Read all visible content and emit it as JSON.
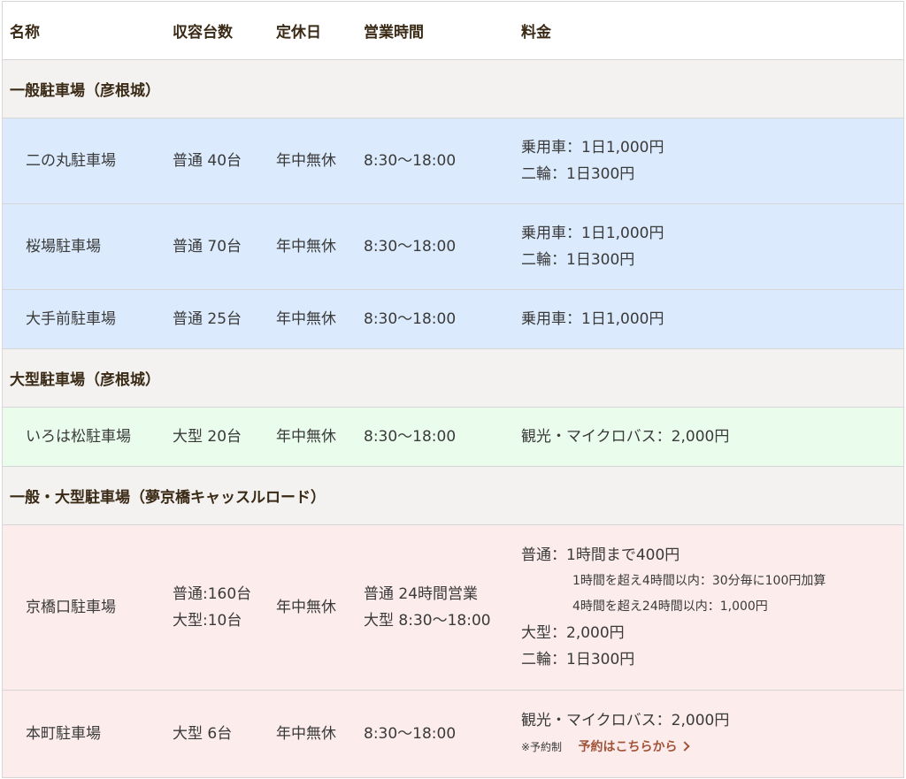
{
  "header": {
    "name": "名称",
    "capacity": "収容台数",
    "closed": "定休日",
    "hours": "営業時間",
    "fee": "料金"
  },
  "sections": [
    {
      "title": "一般駐車場（彦根城）",
      "rows": [
        {
          "name": "二の丸駐車場",
          "capacity": "普通 40台",
          "closed": "年中無休",
          "hours": "8:30〜18:00",
          "fee": [
            "乗用車：1日1,000円",
            "二輪：1日300円"
          ]
        },
        {
          "name": "桜場駐車場",
          "capacity": "普通 70台",
          "closed": "年中無休",
          "hours": "8:30〜18:00",
          "fee": [
            "乗用車：1日1,000円",
            "二輪：1日300円"
          ]
        },
        {
          "name": "大手前駐車場",
          "capacity": "普通 25台",
          "closed": "年中無休",
          "hours": "8:30〜18:00",
          "fee": [
            "乗用車：1日1,000円"
          ]
        }
      ]
    },
    {
      "title": "大型駐車場（彦根城）",
      "rows": [
        {
          "name": "いろは松駐車場",
          "capacity": "大型 20台",
          "closed": "年中無休",
          "hours": "8:30〜18:00",
          "fee": [
            "観光・マイクロバス：2,000円"
          ]
        }
      ]
    },
    {
      "title": "一般・大型駐車場（夢京橋キャッスルロード）",
      "rows": [
        {
          "name": "京橋口駐車場",
          "capacity": [
            "普通:160台",
            "大型:10台"
          ],
          "closed": "年中無休",
          "hours": [
            "普通 24時間営業",
            "大型 8:30〜18:00"
          ],
          "fee": [
            "普通：1時間まで400円",
            "1時間を超え4時間以内：30分毎に100円加算",
            "4時間を超え24時間以内：1,000円",
            "大型：2,000円",
            "二輪：1日300円"
          ]
        },
        {
          "name": "本町駐車場",
          "capacity": "大型 6台",
          "closed": "年中無休",
          "hours": "8:30〜18:00",
          "fee": [
            "観光・マイクロバス：2,000円"
          ],
          "note": "※予約制",
          "link": "予約はこちらから"
        }
      ]
    }
  ],
  "colors": {
    "blue_row": "#dbeafc",
    "green_row": "#eafded",
    "pink_row": "#fcecec",
    "section_bg": "#f3f2f1",
    "link": "#a0543a"
  }
}
